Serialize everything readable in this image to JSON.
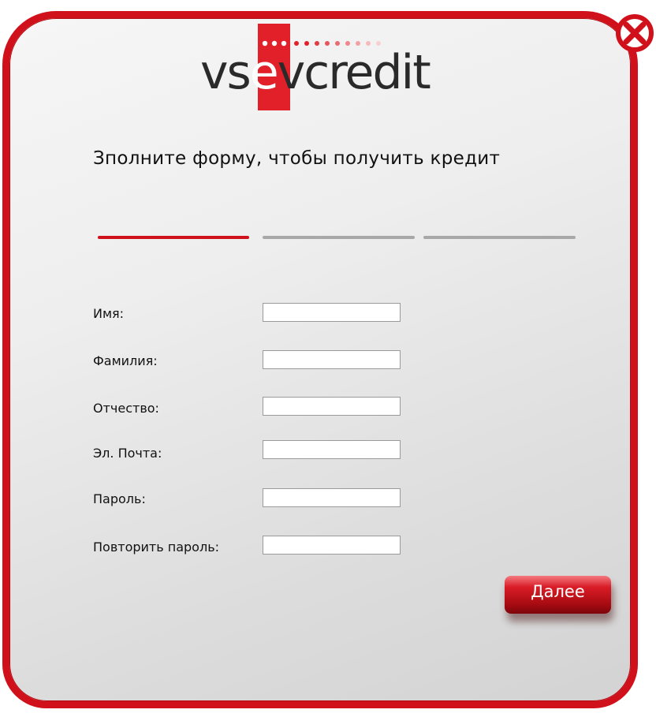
{
  "window": {
    "close_icon": "close-x-icon"
  },
  "logo": {
    "prefix": "vs",
    "highlight": "e",
    "suffix": "vcredit",
    "brand_color": "#e2202a"
  },
  "form": {
    "title": "Зполните форму, чтобы получить кредит",
    "steps": [
      {
        "state": "active",
        "color": "#d0111b"
      },
      {
        "state": "inactive",
        "color": "#a8a8a8"
      },
      {
        "state": "inactive",
        "color": "#a8a8a8"
      }
    ],
    "fields": [
      {
        "label": "Имя:",
        "value": ""
      },
      {
        "label": "Фамилия:",
        "value": ""
      },
      {
        "label": "Отчество:",
        "value": ""
      },
      {
        "label": "Эл. Почта:",
        "value": ""
      },
      {
        "label": "Пароль:",
        "value": ""
      },
      {
        "label": "Повторить пароль:",
        "value": ""
      }
    ],
    "next_label": "Далее"
  },
  "colors": {
    "accent": "#d0111b",
    "button": "#c3131c"
  }
}
